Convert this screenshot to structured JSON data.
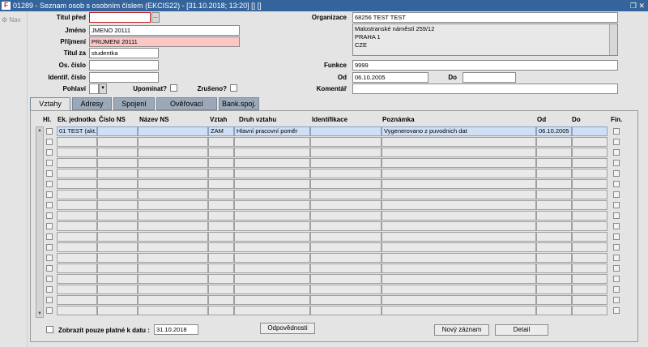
{
  "window": {
    "title": "01289 - Seznam osob s osobním číslem (EKCIS22) - [31.10.2018; 13:20] [] []",
    "app_icon": "F"
  },
  "leftbar": {
    "nav_label": "Nav"
  },
  "form": {
    "titul_pred": {
      "label": "Titul před",
      "value": ""
    },
    "jmeno": {
      "label": "Jméno",
      "value": "JMENO 20111"
    },
    "prijmeni": {
      "label": "Příjmení",
      "value": "PRIJMENI 20111"
    },
    "titul_za": {
      "label": "Titul za",
      "value": "studentka"
    },
    "os_cislo": {
      "label": "Os. číslo",
      "value": ""
    },
    "identif_cislo": {
      "label": "Identif. číslo",
      "value": ""
    },
    "pohlavi": {
      "label": "Pohlaví",
      "value": ""
    },
    "upominat": {
      "label": "Upomínat?"
    },
    "zruseno": {
      "label": "Zrušeno?"
    },
    "organizace": {
      "label": "Organizace",
      "value": "68256 TEST TEST"
    },
    "address_lines": [
      "Malostranské náměstí 259/12",
      "PRAHA 1",
      "CZE"
    ],
    "funkce": {
      "label": "Funkce",
      "value": "9999"
    },
    "od": {
      "label": "Od",
      "value": "06.10.2005"
    },
    "do": {
      "label": "Do",
      "value": ""
    },
    "komentar": {
      "label": "Komentář",
      "value": ""
    },
    "ellipsis_glyph": "...",
    "dropdown_glyph": "▾"
  },
  "tabs": [
    "Vztahy",
    "Adresy",
    "Spojení",
    "Ověřovací doložka",
    "Bank.spoj."
  ],
  "grid": {
    "columns": {
      "hl": "Hl.",
      "ek": "Ek. jednotka",
      "cislo_ns": "Číslo NS",
      "nazev_ns": "Název NS",
      "vztah": "Vztah",
      "druh": "Druh vztahu",
      "ident": "Identifikace",
      "pozn": "Poznámka",
      "od": "Od",
      "do": "Do",
      "fin": "Fin."
    },
    "first_row": {
      "ek": "01 TEST (akt.",
      "cislo_ns": "",
      "nazev_ns": "",
      "vztah": "ZAM",
      "druh": "Hlavní pracovní poměr",
      "ident": "",
      "pozn": "Vygenerovano z puvodnich dat",
      "od": "06.10.2005",
      "do": ""
    },
    "empty_row_count": 17
  },
  "footer": {
    "filter_label": "Zobrazit pouze platné k datu :",
    "filter_date": "31.10.2018",
    "odpovednosti_label": "Odpovědnosti",
    "novy_zaznam_label": "Nový záznam",
    "detail_label": "Detail"
  }
}
